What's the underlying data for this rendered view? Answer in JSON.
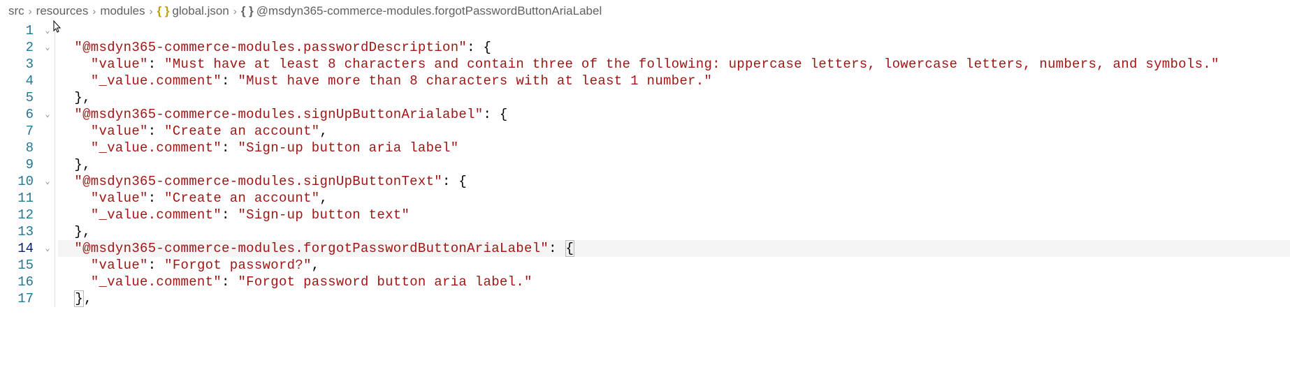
{
  "breadcrumb": {
    "items": [
      {
        "label": "src"
      },
      {
        "label": "resources"
      },
      {
        "label": "modules"
      },
      {
        "label": "global.json",
        "icon": "{ }",
        "iconColor": "yellow"
      },
      {
        "label": "@msdyn365-commerce-modules.forgotPasswordButtonAriaLabel",
        "icon": "{ }",
        "iconColor": "gray"
      }
    ]
  },
  "editor": {
    "lineNumbers": [
      "1",
      "2",
      "3",
      "4",
      "5",
      "6",
      "7",
      "8",
      "9",
      "10",
      "11",
      "12",
      "13",
      "14",
      "15",
      "16",
      "17"
    ],
    "currentLine": 14,
    "foldable": [
      1,
      2,
      6,
      10,
      14
    ]
  },
  "code": {
    "line2_key": "\"@msdyn365-commerce-modules.passwordDescription\"",
    "line3_key": "\"value\"",
    "line3_val": "\"Must have at least 8 characters and contain three of the following: uppercase letters, lowercase letters, numbers, and symbols.\"",
    "line4_key": "\"_value.comment\"",
    "line4_val": "\"Must have more than 8 characters with at least 1 number.\"",
    "line6_key": "\"@msdyn365-commerce-modules.signUpButtonArialabel\"",
    "line7_key": "\"value\"",
    "line7_val": "\"Create an account\"",
    "line8_key": "\"_value.comment\"",
    "line8_val": "\"Sign-up button aria label\"",
    "line10_key": "\"@msdyn365-commerce-modules.signUpButtonText\"",
    "line11_key": "\"value\"",
    "line11_val": "\"Create an account\"",
    "line12_key": "\"_value.comment\"",
    "line12_val": "\"Sign-up button text\"",
    "line14_key": "\"@msdyn365-commerce-modules.forgotPasswordButtonAriaLabel\"",
    "line15_key": "\"value\"",
    "line15_val": "\"Forgot password?\"",
    "line16_key": "\"_value.comment\"",
    "line16_val": "\"Forgot password button aria label.\""
  }
}
